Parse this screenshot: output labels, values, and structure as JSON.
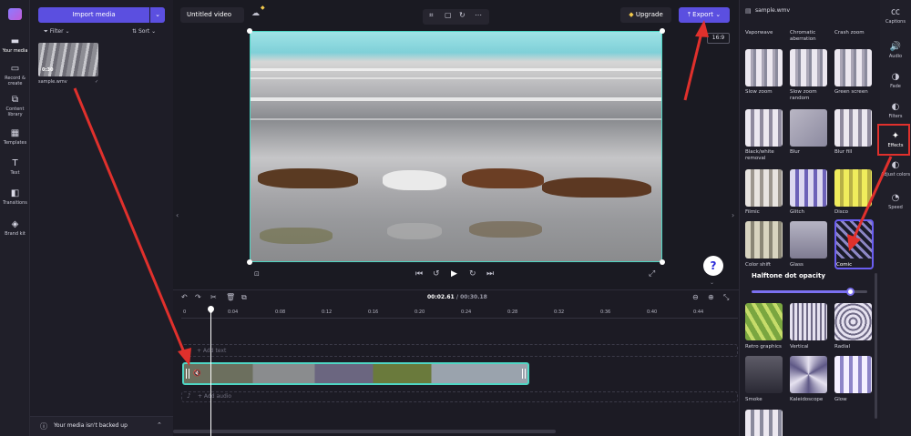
{
  "app": {
    "project_title": "Untitled video",
    "upgrade_label": "Upgrade",
    "export_label": "Export",
    "aspect_ratio": "16:9",
    "help_label": "?"
  },
  "left_nav": [
    {
      "label": "Your media",
      "icon": "folder-icon"
    },
    {
      "label": "Record & create",
      "icon": "record-icon"
    },
    {
      "label": "Content library",
      "icon": "library-icon"
    },
    {
      "label": "Templates",
      "icon": "templates-icon"
    },
    {
      "label": "Text",
      "icon": "text-icon"
    },
    {
      "label": "Transitions",
      "icon": "transitions-icon"
    },
    {
      "label": "Brand kit",
      "icon": "brand-icon"
    }
  ],
  "media": {
    "import_label": "Import media",
    "filter_label": "Filter",
    "sort_label": "Sort",
    "item_name": "sample.wmv",
    "item_duration": "0:30",
    "backup_text": "Your media isn't backed up"
  },
  "timeline": {
    "current_time": "00:02.61",
    "total_time": "00:30.18",
    "time_separator": "/",
    "ticks": [
      "0",
      "0:04",
      "0:08",
      "0:12",
      "0:16",
      "0:20",
      "0:24",
      "0:28",
      "0:32",
      "0:36",
      "0:40",
      "0:44"
    ],
    "add_text_label": "+ Add text",
    "add_audio_label": "+ Add audio"
  },
  "effects_panel": {
    "title": "sample.wmv",
    "top_labels": [
      "Vaporwave",
      "Chromatic aberration",
      "Crash zoom"
    ],
    "effects": [
      {
        "label": "Slow zoom"
      },
      {
        "label": "Slow zoom random"
      },
      {
        "label": "Green screen"
      },
      {
        "label": "Black/white removal"
      },
      {
        "label": "Blur"
      },
      {
        "label": "Blur fill"
      },
      {
        "label": "Filmic"
      },
      {
        "label": "Glitch"
      },
      {
        "label": "Disco"
      },
      {
        "label": "Color shift"
      },
      {
        "label": "Glass"
      },
      {
        "label": "Comic"
      },
      {
        "label": "Retro graphics"
      },
      {
        "label": "Vertical"
      },
      {
        "label": "Radial"
      },
      {
        "label": "Smoke"
      },
      {
        "label": "Kaleidoscope"
      },
      {
        "label": "Glow"
      }
    ],
    "slider_label": "Halftone dot opacity",
    "slider_value": 0.85
  },
  "right_nav": [
    {
      "label": "Captions",
      "icon": "captions-icon"
    },
    {
      "label": "Audio",
      "icon": "audio-icon"
    },
    {
      "label": "Fade",
      "icon": "fade-icon"
    },
    {
      "label": "Filters",
      "icon": "filters-icon"
    },
    {
      "label": "Effects",
      "icon": "effects-icon"
    },
    {
      "label": "Adjust colors",
      "icon": "adjust-colors-icon"
    },
    {
      "label": "Speed",
      "icon": "speed-icon"
    }
  ],
  "colors": {
    "accent": "#5b4fe0",
    "selection": "#4fd6c4",
    "annotation": "#e0302c"
  }
}
